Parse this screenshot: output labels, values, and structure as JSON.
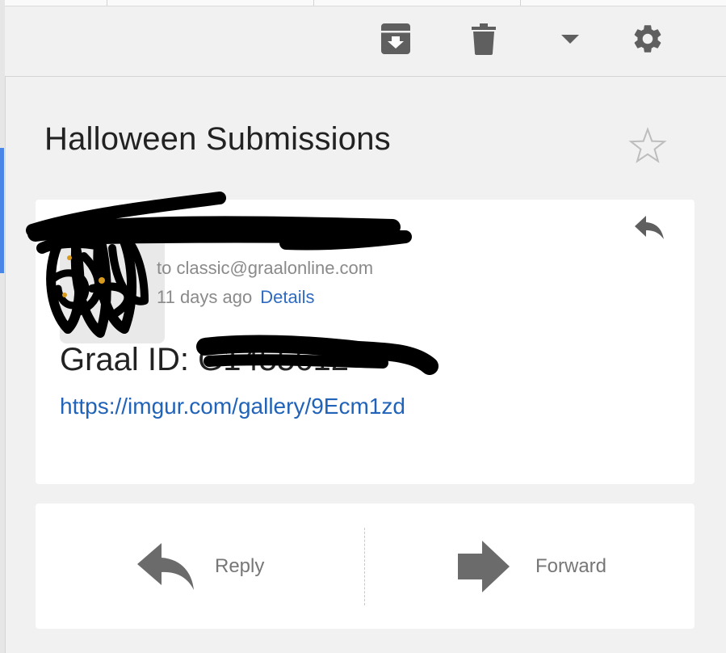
{
  "toolbar": {
    "archive_icon": "archive-icon",
    "delete_icon": "trash-icon",
    "more_icon": "dropdown-arrow-icon",
    "settings_icon": "gear-icon"
  },
  "email": {
    "subject": "Halloween Submissions",
    "sender_name": "",
    "to_line": "to classic@graalonline.com",
    "time": "11 days ago",
    "details_label": "Details",
    "body_prefix": "Graal ID: ",
    "body_id": "G1455612",
    "body_link": "https://imgur.com/gallery/9Ecm1zd"
  },
  "actions": {
    "reply_label": "Reply",
    "forward_label": "Forward"
  },
  "colors": {
    "link": "#2163b8",
    "accent": "#4a86e8",
    "icon": "#5f5f5f"
  }
}
